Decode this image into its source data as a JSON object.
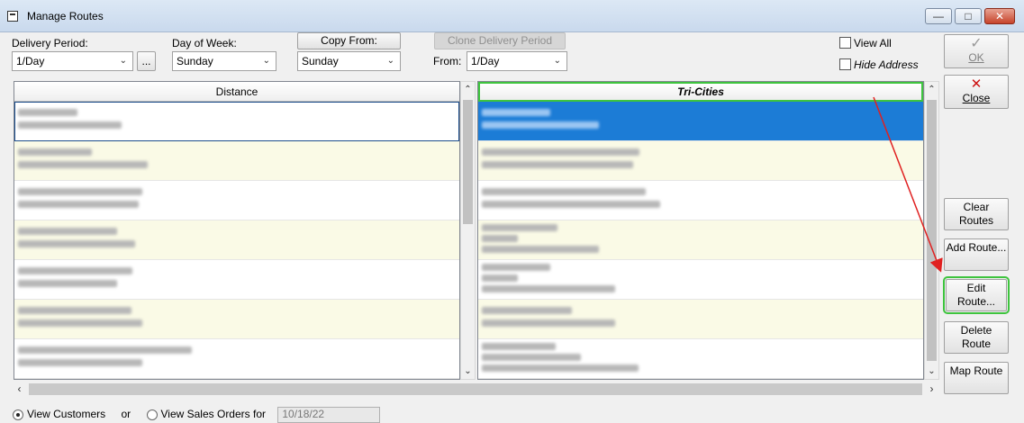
{
  "window": {
    "title": "Manage Routes",
    "min_glyph": "—",
    "max_glyph": "□",
    "close_glyph": "✕"
  },
  "filters": {
    "delivery_period_label": "Delivery Period:",
    "delivery_period_value": "1/Day",
    "browse_label": "...",
    "day_of_week_label": "Day of Week:",
    "day_of_week_value": "Sunday",
    "copy_from_label": "Copy From:",
    "copy_from_value": "Sunday",
    "clone_label": "Clone Delivery Period",
    "from_label": "From:",
    "from_value": "1/Day",
    "view_all_label": "View All",
    "hide_address_label": "Hide Address",
    "view_all_checked": false,
    "hide_address_checked": false
  },
  "routes": [
    {
      "name": "Distance",
      "highlighted": false
    },
    {
      "name": "Tri-Cities",
      "highlighted": true
    }
  ],
  "buttons": {
    "ok": "OK",
    "close": "Close",
    "clear_routes": "Clear Routes",
    "add_route": "Add Route...",
    "edit_route": "Edit Route...",
    "delete_route": "Delete Route",
    "map_route": "Map Route"
  },
  "bottom": {
    "view_customers": "View Customers",
    "or": "or",
    "view_sales_orders": "View Sales Orders for",
    "date_value": "10/18/22"
  },
  "colors": {
    "selected_row": "#1c7cd6",
    "alt_row": "#fafae6",
    "highlight": "#3ec43e",
    "arrow": "#e02020"
  }
}
